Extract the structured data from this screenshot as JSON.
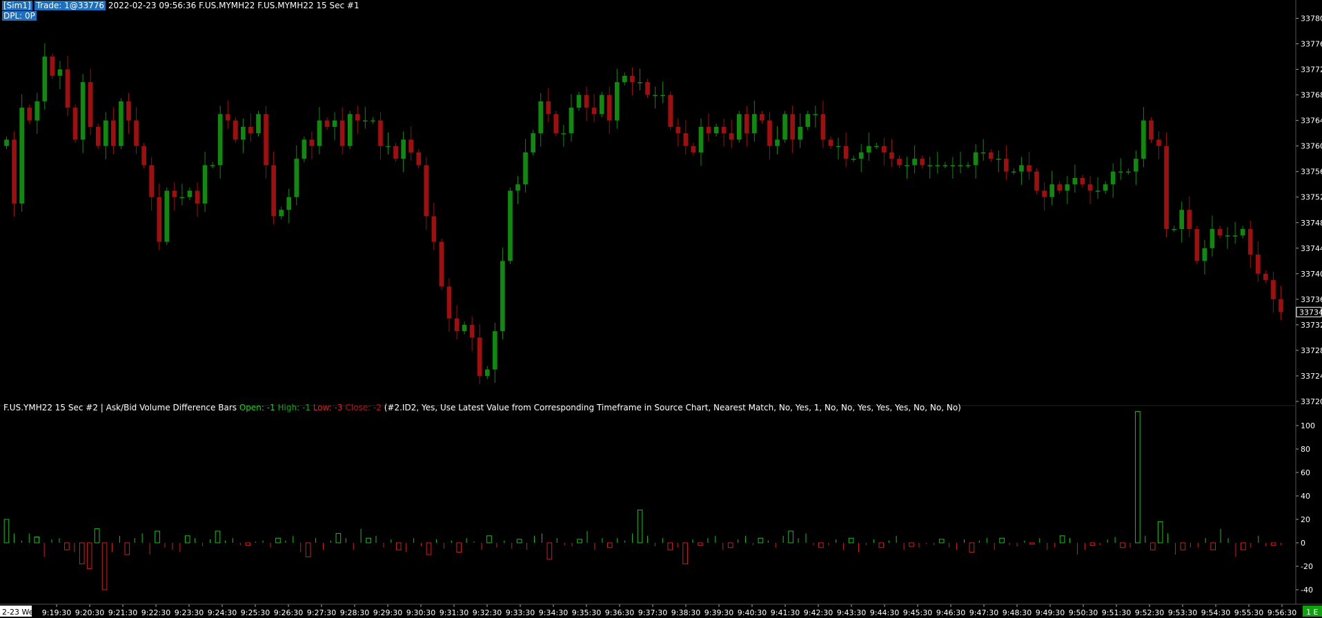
{
  "header": {
    "account": "[Sim1]",
    "trade": "Trade: 1@33776",
    "info": "2022-02-23 09:56:36 F.US.MYMH22 F.US.MYMH22  15 Sec   #1",
    "dpl": "DPL: 0P"
  },
  "indicator_header": {
    "prefix": "F.US.YMH22  15 Sec   #2 | Ask/Bid Volume Difference Bars",
    "open": "Open: -1",
    "high": "High: -1",
    "low": "Low: -3",
    "close": "Close: -2",
    "params": "(#2.ID2, Yes, Use Latest Value from Corresponding Timeframe in Source Chart, Nearest Match, No, Yes, 1, No, No, Yes, Yes, Yes, No, No, No)"
  },
  "price_axis": {
    "ticks": [
      "33780",
      "33776",
      "33772",
      "33768",
      "33764",
      "33760",
      "33756",
      "33752",
      "33748",
      "33744",
      "33740",
      "33736",
      "33732",
      "33728",
      "33724",
      "33720"
    ],
    "last_price_label": "33734"
  },
  "volume_axis": {
    "ticks": [
      "100",
      "80",
      "60",
      "40",
      "20",
      "0",
      "-20",
      "-40"
    ]
  },
  "time_axis": {
    "start_label": "2-23 We",
    "ticks": [
      "9:19:30",
      "9:20:30",
      "9:21:30",
      "9:22:30",
      "9:23:30",
      "9:24:30",
      "9:25:30",
      "9:26:30",
      "9:27:30",
      "9:28:30",
      "9:29:30",
      "9:30:30",
      "9:31:30",
      "9:32:30",
      "9:33:30",
      "9:34:30",
      "9:35:30",
      "9:36:30",
      "9:37:30",
      "9:38:30",
      "9:39:30",
      "9:40:30",
      "9:41:30",
      "9:42:30",
      "9:43:30",
      "9:44:30",
      "9:45:30",
      "9:46:30",
      "9:47:30",
      "9:48:30",
      "9:49:30",
      "9:50:30",
      "9:51:30",
      "9:52:30",
      "9:53:30",
      "9:54:30",
      "9:55:30",
      "9:56:30"
    ],
    "right_badge": "1 E"
  },
  "colors": {
    "up": "#0f8a0f",
    "down": "#a00f0f",
    "vol_up": "#16c216",
    "vol_down": "#d21e1e",
    "background": "#000000",
    "text": "#ffffff",
    "header_highlight": "#1f6fbf",
    "badge": "#10a010"
  },
  "chart_data": [
    {
      "type": "candlestick",
      "title": "F.US.MYMH22 15 Sec",
      "ylim": [
        33720,
        33782
      ],
      "x_range_labels": [
        "9:19:30",
        "9:56:30"
      ],
      "closes": [
        33761,
        33751,
        33766,
        33764,
        33767,
        33774,
        33771,
        33772,
        33766,
        33761,
        33770,
        33763,
        33760,
        33764,
        33760,
        33767,
        33764,
        33760,
        33757,
        33752,
        33745,
        33753,
        33752,
        33752,
        33753,
        33751,
        33757,
        33757,
        33765,
        33764,
        33761,
        33763,
        33762,
        33765,
        33757,
        33749,
        33750,
        33752,
        33758,
        33761,
        33760,
        33764,
        33763,
        33764,
        33760,
        33765,
        33764,
        33764,
        33764,
        33760,
        33760,
        33758,
        33761,
        33759,
        33757,
        33749,
        33745,
        33738,
        33733,
        33731,
        33732,
        33730,
        33724,
        33725,
        33731,
        33742,
        33753,
        33754,
        33759,
        33762,
        33767,
        33765,
        33762,
        33762,
        33766,
        33768,
        33766,
        33765,
        33768,
        33764,
        33770,
        33771,
        33770,
        33770,
        33768,
        33768,
        33768,
        33763,
        33762,
        33760,
        33759,
        33763,
        33762,
        33763,
        33762,
        33761,
        33765,
        33762,
        33765,
        33764,
        33760,
        33761,
        33765,
        33761,
        33763,
        33765,
        33765,
        33761,
        33760,
        33760,
        33758,
        33758,
        33759,
        33760,
        33760,
        33759,
        33758,
        33757,
        33757,
        33758,
        33757,
        33757,
        33757,
        33757,
        33757,
        33757,
        33757,
        33759,
        33759,
        33758,
        33758,
        33756,
        33756,
        33757,
        33756,
        33753,
        33752,
        33754,
        33753,
        33754,
        33755,
        33754,
        33753,
        33753,
        33754,
        33756,
        33756,
        33756,
        33758,
        33764,
        33761,
        33760,
        33747,
        33747,
        33750,
        33747,
        33742,
        33744,
        33747,
        33746,
        33746,
        33746,
        33747,
        33743,
        33740,
        33739,
        33736,
        33734
      ],
      "bars_encoding": "close per 15-sec bar; candle color green when close >= open"
    },
    {
      "type": "bar",
      "title": "Ask/Bid Volume Difference Bars",
      "ylim": [
        -50,
        110
      ],
      "values": [
        20,
        8,
        2,
        8,
        5,
        -12,
        3,
        4,
        -6,
        -8,
        -18,
        -22,
        12,
        -40,
        -8,
        6,
        -10,
        4,
        8,
        -10,
        10,
        -4,
        -6,
        -8,
        6,
        4,
        -3,
        3,
        10,
        2,
        4,
        -2,
        -2,
        1,
        2,
        -4,
        4,
        2,
        6,
        -8,
        -12,
        4,
        -6,
        2,
        8,
        4,
        -6,
        12,
        4,
        6,
        -4,
        3,
        -6,
        -8,
        4,
        -3,
        -10,
        3,
        -5,
        2,
        -8,
        4,
        1,
        -6,
        6,
        -4,
        2,
        -5,
        3,
        -6,
        6,
        8,
        -14,
        4,
        -2,
        -3,
        3,
        10,
        -6,
        4,
        -4,
        4,
        2,
        8,
        28,
        6,
        -3,
        4,
        -6,
        -4,
        -18,
        3,
        -2,
        4,
        6,
        -6,
        -4,
        3,
        6,
        -2,
        4,
        2,
        -4,
        6,
        10,
        4,
        8,
        -2,
        -4,
        -2,
        3,
        -6,
        4,
        -8,
        -2,
        3,
        -4,
        2,
        6,
        -6,
        -3,
        -4,
        -1,
        -2,
        3,
        -4,
        -6,
        3,
        -8,
        2,
        4,
        -6,
        4,
        -2,
        -3,
        2,
        -1,
        4,
        -6,
        -4,
        6,
        4,
        -10,
        -6,
        -2,
        -2,
        3,
        5,
        -4,
        -4,
        112,
        6,
        -6,
        18,
        8,
        -10,
        -6,
        -4,
        -4,
        4,
        -6,
        12,
        4,
        -12,
        -6,
        -4,
        6,
        -3,
        -2,
        -2
      ]
    }
  ]
}
